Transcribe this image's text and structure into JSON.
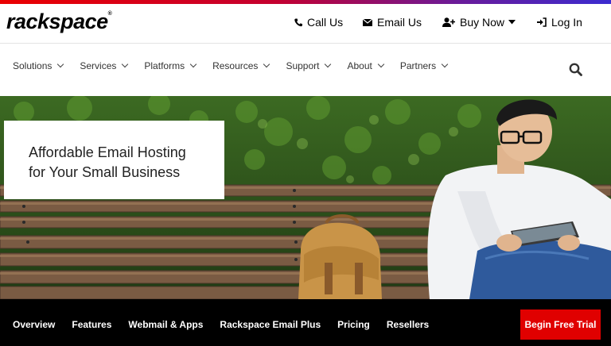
{
  "brand": {
    "name": "rackspace",
    "mark": "®"
  },
  "utility": {
    "call": "Call Us",
    "email": "Email Us",
    "buy": "Buy Now",
    "login": "Log In"
  },
  "nav": {
    "items": [
      "Solutions",
      "Services",
      "Platforms",
      "Resources",
      "Support",
      "About",
      "Partners"
    ]
  },
  "hero": {
    "title_line1": "Affordable Email Hosting",
    "title_line2": "for Your Small Business"
  },
  "subnav": {
    "links": [
      "Overview",
      "Features",
      "Webmail & Apps",
      "Rackspace Email Plus",
      "Pricing",
      "Resellers"
    ],
    "cta": "Begin Free Trial"
  },
  "colors": {
    "accent": "#e00000",
    "subnav_bg": "#000000"
  }
}
